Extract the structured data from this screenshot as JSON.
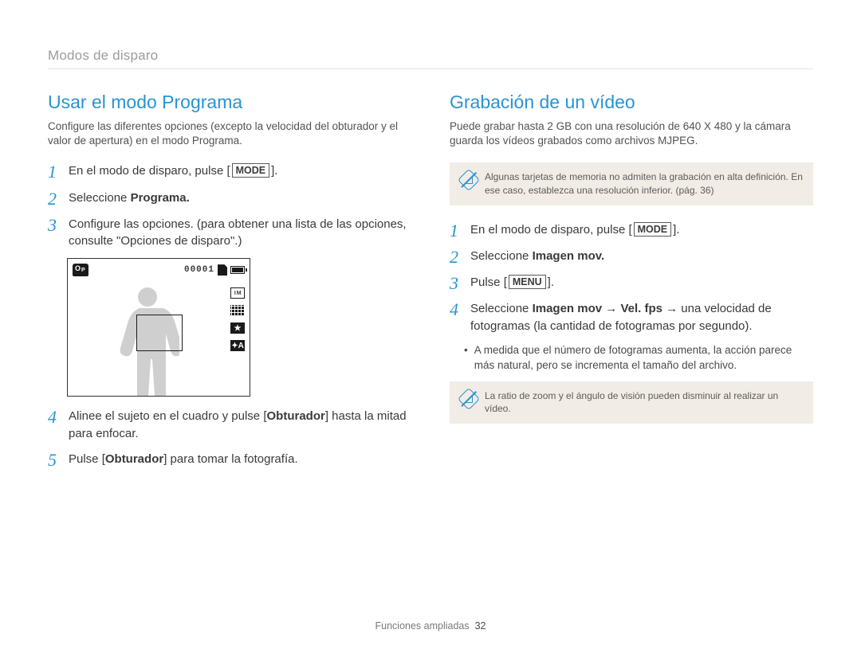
{
  "breadcrumb": "Modos de disparo",
  "left": {
    "title": "Usar el modo Programa",
    "intro": "Configure las diferentes opciones (excepto la velocidad del obturador y el valor de apertura) en el modo Programa.",
    "steps": {
      "s1_pre": "En el modo de disparo, pulse [",
      "s1_key": "MODE",
      "s1_post": "].",
      "s2_pre": "Seleccione ",
      "s2_bold": "Programa.",
      "s3": "Configure las opciones. (para obtener una lista de las opciones, consulte \"Opciones de disparo\".)",
      "s4_a": "Alinee el sujeto en el cuadro y pulse [",
      "s4_b": "Obturador",
      "s4_c": "] hasta la mitad para enfocar.",
      "s5_a": "Pulse [",
      "s5_b": "Obturador",
      "s5_c": "] para tomar la fotografía."
    },
    "lcd": {
      "counter": "00001",
      "side1": "I M",
      "side3": "★",
      "side4": "✦A"
    }
  },
  "right": {
    "title": "Grabación de un vídeo",
    "intro": "Puede grabar hasta 2 GB con una resolución de 640 X 480 y la cámara guarda los vídeos grabados como archivos MJPEG.",
    "note1": "Algunas tarjetas de memoria no admiten la grabación en alta definición. En ese caso, establezca una resolución inferior. (pág. 36)",
    "steps": {
      "s1_pre": "En el modo de disparo, pulse [",
      "s1_key": "MODE",
      "s1_post": "].",
      "s2_pre": "Seleccione ",
      "s2_bold": "Imagen mov.",
      "s3_pre": "Pulse [",
      "s3_key": "MENU",
      "s3_post": "].",
      "s4_a": "Seleccione ",
      "s4_b": "Imagen mov",
      "s4_c": " → ",
      "s4_d": "Vel. fps",
      "s4_e": " → una velocidad de fotogramas (la cantidad de fotogramas por segundo).",
      "s4_sub": "A medida que el número de fotogramas aumenta, la acción parece más natural, pero se incrementa el tamaño del archivo."
    },
    "note2": "La ratio de zoom y el ángulo de visión pueden disminuir al realizar un vídeo."
  },
  "footer": {
    "label": "Funciones ampliadas",
    "page": "32"
  }
}
